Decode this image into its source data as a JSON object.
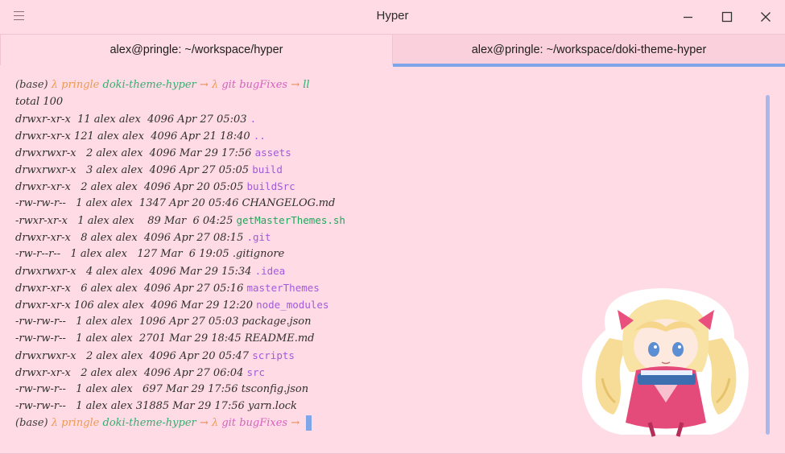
{
  "window": {
    "title": "Hyper"
  },
  "tabs": [
    {
      "label": "alex@pringle: ~/workspace/hyper",
      "active": false
    },
    {
      "label": "alex@pringle: ~/workspace/doki-theme-hyper",
      "active": true
    }
  ],
  "prompt": {
    "env": "(base)",
    "lambda": "λ",
    "host": "pringle",
    "dir": "doki-theme-hyper",
    "arrow": "→",
    "vcs": "git",
    "branch": "bugFixes",
    "command": "ll"
  },
  "listing": {
    "total": "total 100",
    "rows": [
      {
        "meta": "drwxr-xr-x  11 alex alex  4096 Apr 27 05:03 ",
        "name": ".",
        "kind": "dir"
      },
      {
        "meta": "drwxr-xr-x 121 alex alex  4096 Apr 21 18:40 ",
        "name": "..",
        "kind": "dir"
      },
      {
        "meta": "drwxrwxr-x   2 alex alex  4096 Mar 29 17:56 ",
        "name": "assets",
        "kind": "dir"
      },
      {
        "meta": "drwxrwxr-x   3 alex alex  4096 Apr 27 05:05 ",
        "name": "build",
        "kind": "dir"
      },
      {
        "meta": "drwxr-xr-x   2 alex alex  4096 Apr 20 05:05 ",
        "name": "buildSrc",
        "kind": "dir"
      },
      {
        "meta": "-rw-rw-r--   1 alex alex  1347 Apr 20 05:46 ",
        "name": "CHANGELOG.md",
        "kind": "file"
      },
      {
        "meta": "-rwxr-xr-x   1 alex alex    89 Mar  6 04:25 ",
        "name": "getMasterThemes.sh",
        "kind": "exec"
      },
      {
        "meta": "drwxr-xr-x   8 alex alex  4096 Apr 27 08:15 ",
        "name": ".git",
        "kind": "dir"
      },
      {
        "meta": "-rw-r--r--   1 alex alex   127 Mar  6 19:05 ",
        "name": ".gitignore",
        "kind": "file"
      },
      {
        "meta": "drwxrwxr-x   4 alex alex  4096 Mar 29 15:34 ",
        "name": ".idea",
        "kind": "dir"
      },
      {
        "meta": "drwxr-xr-x   6 alex alex  4096 Apr 27 05:16 ",
        "name": "masterThemes",
        "kind": "dir"
      },
      {
        "meta": "drwxr-xr-x 106 alex alex  4096 Mar 29 12:20 ",
        "name": "node_modules",
        "kind": "dir"
      },
      {
        "meta": "-rw-rw-r--   1 alex alex  1096 Apr 27 05:03 ",
        "name": "package.json",
        "kind": "file"
      },
      {
        "meta": "-rw-rw-r--   1 alex alex  2701 Mar 29 18:45 ",
        "name": "README.md",
        "kind": "file"
      },
      {
        "meta": "drwxrwxr-x   2 alex alex  4096 Apr 20 05:47 ",
        "name": "scripts",
        "kind": "dir"
      },
      {
        "meta": "drwxr-xr-x   2 alex alex  4096 Apr 27 06:04 ",
        "name": "src",
        "kind": "dir"
      },
      {
        "meta": "-rw-rw-r--   1 alex alex   697 Mar 29 17:56 ",
        "name": "tsconfig.json",
        "kind": "file"
      },
      {
        "meta": "-rw-rw-r--   1 alex alex 31885 Mar 29 17:56 ",
        "name": "yarn.lock",
        "kind": "file"
      }
    ]
  },
  "colors": {
    "background": "#ffdbe6",
    "accent": "#7fa6e8",
    "dir": "#a25ad8",
    "exec": "#1fa85a"
  },
  "icons": {
    "menu": "hamburger-icon",
    "minimize": "minimize-icon",
    "maximize": "maximize-icon",
    "close": "close-icon"
  }
}
